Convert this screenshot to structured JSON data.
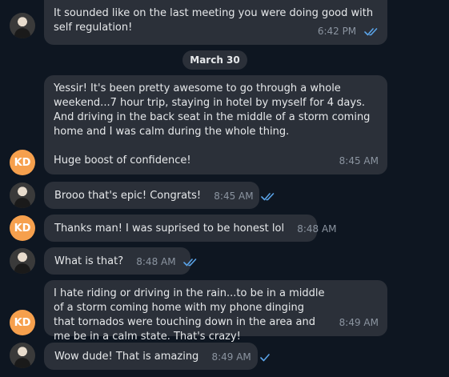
{
  "colors": {
    "background": "#0e1621",
    "bubble": "#2b3039",
    "text": "#e6e8ea",
    "meta": "#8b94a0",
    "read_check": "#5aa3e8",
    "kd_avatar": "#f6a04d"
  },
  "messages": [
    {
      "text": "It sounded like on the last meeting you were doing good with self regulation!",
      "time": "6:42 PM",
      "status": "read"
    },
    {
      "text": "Yessir! It's been pretty awesome to go through a whole weekend...7 hour trip, staying in hotel by myself for 4 days. And driving in the back seat in the middle of a storm coming home and I was calm during the whole thing.",
      "text2": "Huge boost of confidence!",
      "time": "8:45 AM",
      "avatar": "KD"
    },
    {
      "text": "Brooo that's epic! Congrats!",
      "time": "8:45 AM",
      "status": "read"
    },
    {
      "text": "Thanks man! I was suprised to be honest lol",
      "time": "8:48 AM",
      "avatar": "KD"
    },
    {
      "text": "What is that?",
      "time": "8:48 AM",
      "status": "read"
    },
    {
      "text": "I hate riding or driving in the rain...to be in a middle of a storm coming home with my phone dinging that tornados were touching down in the area and me be in a calm state. That's crazy!",
      "time": "8:49 AM",
      "avatar": "KD"
    },
    {
      "text": "Wow dude! That is amazing",
      "time": "8:49 AM",
      "status": "sent"
    }
  ],
  "date_separator": "March 30",
  "icons": {
    "double_check": "double-check-icon",
    "single_check": "check-icon"
  }
}
